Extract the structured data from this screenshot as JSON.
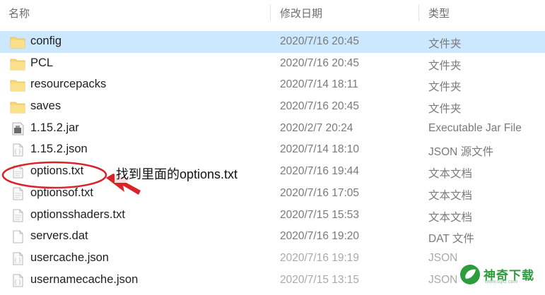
{
  "columns": {
    "name": "名称",
    "date": "修改日期",
    "type": "类型"
  },
  "files": [
    {
      "name": "config",
      "date": "2020/7/16 20:45",
      "type": "文件夹",
      "icon": "folder-icon"
    },
    {
      "name": "PCL",
      "date": "2020/7/16 20:45",
      "type": "文件夹",
      "icon": "folder-icon"
    },
    {
      "name": "resourcepacks",
      "date": "2020/7/14 18:11",
      "type": "文件夹",
      "icon": "folder-icon"
    },
    {
      "name": "saves",
      "date": "2020/7/16 20:45",
      "type": "文件夹",
      "icon": "folder-icon"
    },
    {
      "name": "1.15.2.jar",
      "date": "2020/2/7 20:24",
      "type": "Executable Jar File",
      "icon": "jar-file-icon"
    },
    {
      "name": "1.15.2.json",
      "date": "2020/7/14 18:10",
      "type": "JSON 源文件",
      "icon": "json-file-icon"
    },
    {
      "name": "options.txt",
      "date": "2020/7/16 19:44",
      "type": "文本文档",
      "icon": "text-file-icon"
    },
    {
      "name": "optionsof.txt",
      "date": "2020/7/16 17:05",
      "type": "文本文档",
      "icon": "text-file-icon"
    },
    {
      "name": "optionsshaders.txt",
      "date": "2020/7/15 15:53",
      "type": "文本文档",
      "icon": "text-file-icon"
    },
    {
      "name": "servers.dat",
      "date": "2020/7/16 19:20",
      "type": "DAT 文件",
      "icon": "dat-file-icon"
    },
    {
      "name": "usercache.json",
      "date": "2020/7/16 19:19",
      "type": "JSON",
      "icon": "json-file-icon"
    },
    {
      "name": "usernamecache.json",
      "date": "2020/7/15 13:15",
      "type": "JSON",
      "icon": "json-file-icon"
    }
  ],
  "annotation": {
    "text": "找到里面的options.txt",
    "color": "#d9232a"
  },
  "watermark": {
    "brand": "神奇下载",
    "site": "www.sqxz.com",
    "color": "#2d9c3c"
  },
  "colors": {
    "selected_row": "#cce8ff",
    "folder": "#f8d775"
  }
}
